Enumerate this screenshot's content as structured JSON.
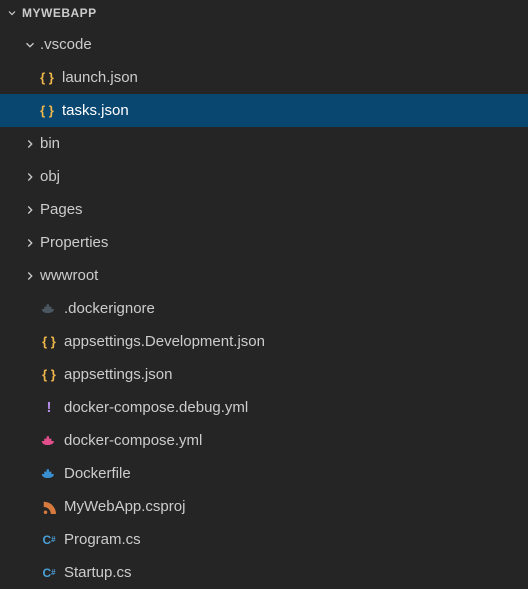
{
  "header": {
    "title": "MYWEBAPP"
  },
  "tree": {
    "folder_vscode": ".vscode",
    "file_launch_json": "launch.json",
    "file_tasks_json": "tasks.json",
    "folder_bin": "bin",
    "folder_obj": "obj",
    "folder_pages": "Pages",
    "folder_properties": "Properties",
    "folder_wwwroot": "wwwroot",
    "file_dockerignore": ".dockerignore",
    "file_appsettings_dev": "appsettings.Development.json",
    "file_appsettings": "appsettings.json",
    "file_compose_debug": "docker-compose.debug.yml",
    "file_compose": "docker-compose.yml",
    "file_dockerfile": "Dockerfile",
    "file_csproj": "MyWebApp.csproj",
    "file_program": "Program.cs",
    "file_startup": "Startup.cs"
  }
}
